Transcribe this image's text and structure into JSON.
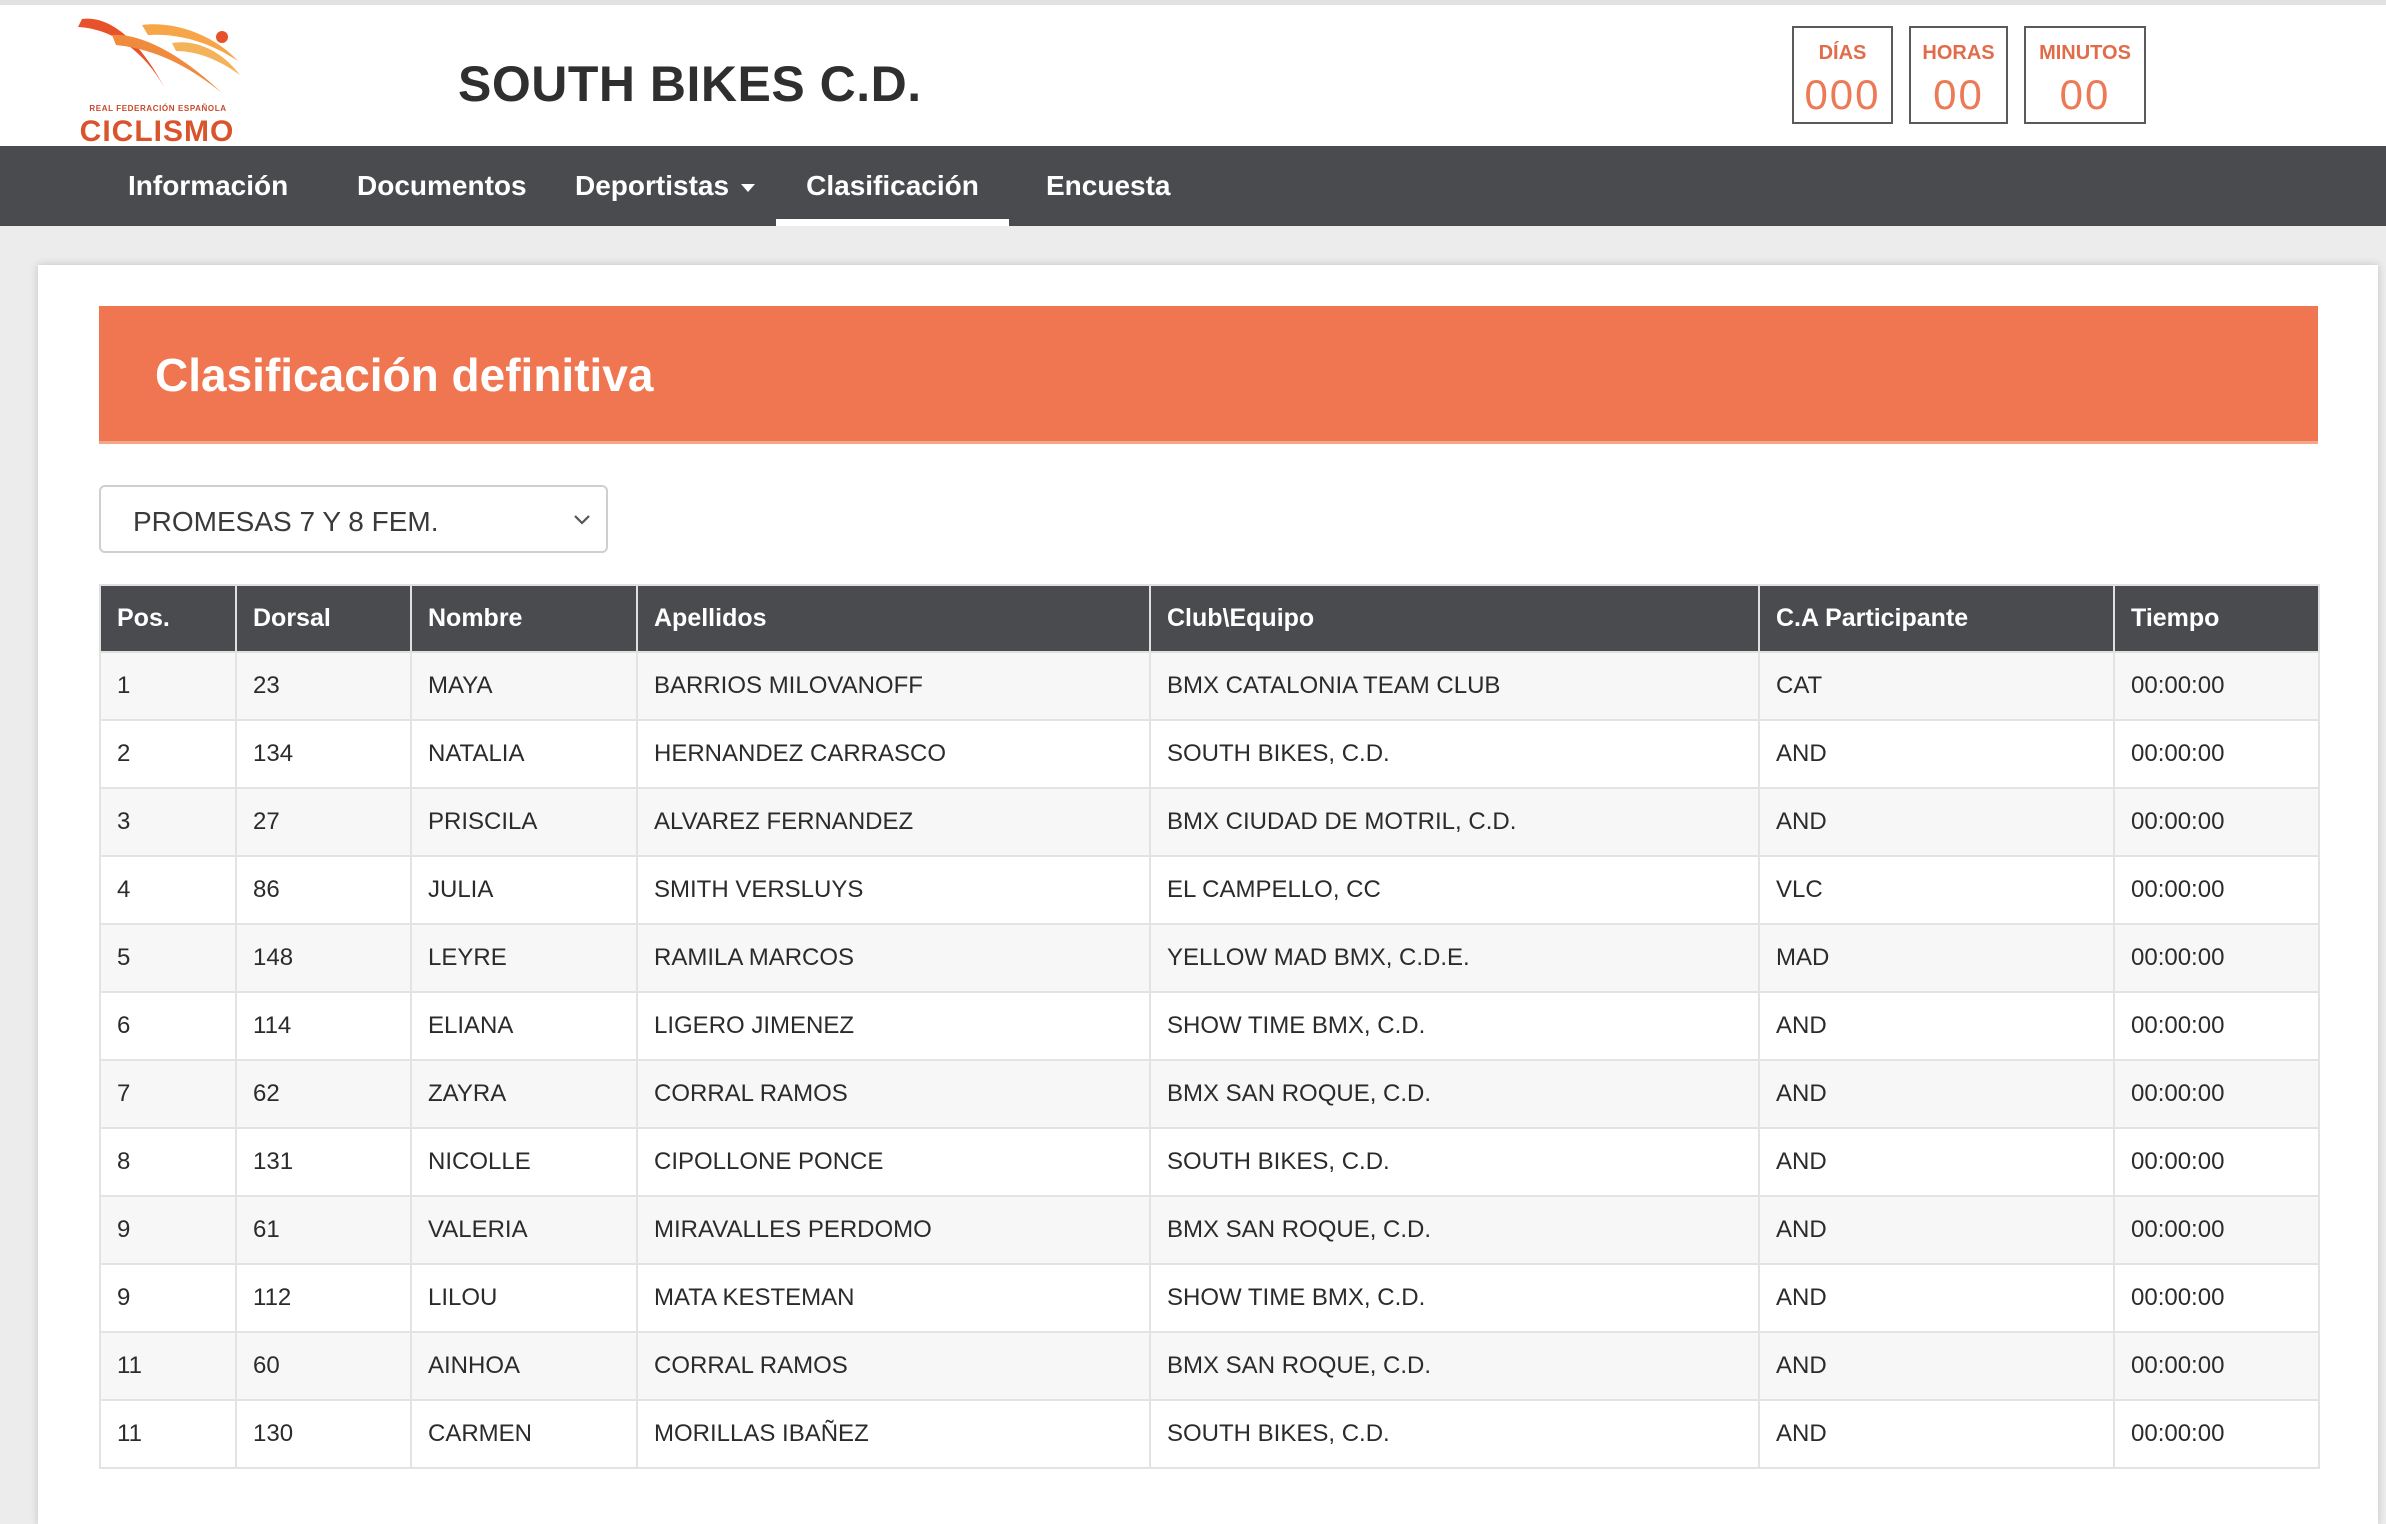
{
  "header": {
    "logo_small": "REAL FEDERACIÓN ESPAÑOLA",
    "logo_big": "CICLISMO",
    "title": "SOUTH BIKES C.D."
  },
  "countdown": [
    {
      "label": "DÍAS",
      "value": "000"
    },
    {
      "label": "HORAS",
      "value": "00"
    },
    {
      "label": "MINUTOS",
      "value": "00"
    }
  ],
  "nav": {
    "items": [
      {
        "label": "Información"
      },
      {
        "label": "Documentos"
      },
      {
        "label": "Deportistas"
      },
      {
        "label": "Clasificación"
      },
      {
        "label": "Encuesta"
      }
    ]
  },
  "main": {
    "heading": "Clasificación definitiva",
    "category_selected": "PROMESAS 7 Y 8 FEM."
  },
  "table": {
    "headers": [
      "Pos.",
      "Dorsal",
      "Nombre",
      "Apellidos",
      "Club\\Equipo",
      "C.A Participante",
      "Tiempo"
    ],
    "rows": [
      [
        "1",
        "23",
        "MAYA",
        "BARRIOS MILOVANOFF",
        "BMX CATALONIA TEAM CLUB",
        "CAT",
        "00:00:00"
      ],
      [
        "2",
        "134",
        "NATALIA",
        "HERNANDEZ CARRASCO",
        "SOUTH BIKES, C.D.",
        "AND",
        "00:00:00"
      ],
      [
        "3",
        "27",
        "PRISCILA",
        "ALVAREZ FERNANDEZ",
        "BMX CIUDAD DE MOTRIL, C.D.",
        "AND",
        "00:00:00"
      ],
      [
        "4",
        "86",
        "JULIA",
        "SMITH VERSLUYS",
        "EL CAMPELLO, CC",
        "VLC",
        "00:00:00"
      ],
      [
        "5",
        "148",
        "LEYRE",
        "RAMILA MARCOS",
        "YELLOW MAD BMX, C.D.E.",
        "MAD",
        "00:00:00"
      ],
      [
        "6",
        "114",
        "ELIANA",
        "LIGERO JIMENEZ",
        "SHOW TIME BMX, C.D.",
        "AND",
        "00:00:00"
      ],
      [
        "7",
        "62",
        "ZAYRA",
        "CORRAL RAMOS",
        "BMX SAN ROQUE, C.D.",
        "AND",
        "00:00:00"
      ],
      [
        "8",
        "131",
        "NICOLLE",
        "CIPOLLONE PONCE",
        "SOUTH BIKES, C.D.",
        "AND",
        "00:00:00"
      ],
      [
        "9",
        "61",
        "VALERIA",
        "MIRAVALLES PERDOMO",
        "BMX SAN ROQUE, C.D.",
        "AND",
        "00:00:00"
      ],
      [
        "9",
        "112",
        "LILOU",
        "MATA KESTEMAN",
        "SHOW TIME BMX, C.D.",
        "AND",
        "00:00:00"
      ],
      [
        "11",
        "60",
        "AINHOA",
        "CORRAL RAMOS",
        "BMX SAN ROQUE, C.D.",
        "AND",
        "00:00:00"
      ],
      [
        "11",
        "130",
        "CARMEN",
        "MORILLAS IBAÑEZ",
        "SOUTH BIKES, C.D.",
        "AND",
        "00:00:00"
      ]
    ]
  }
}
